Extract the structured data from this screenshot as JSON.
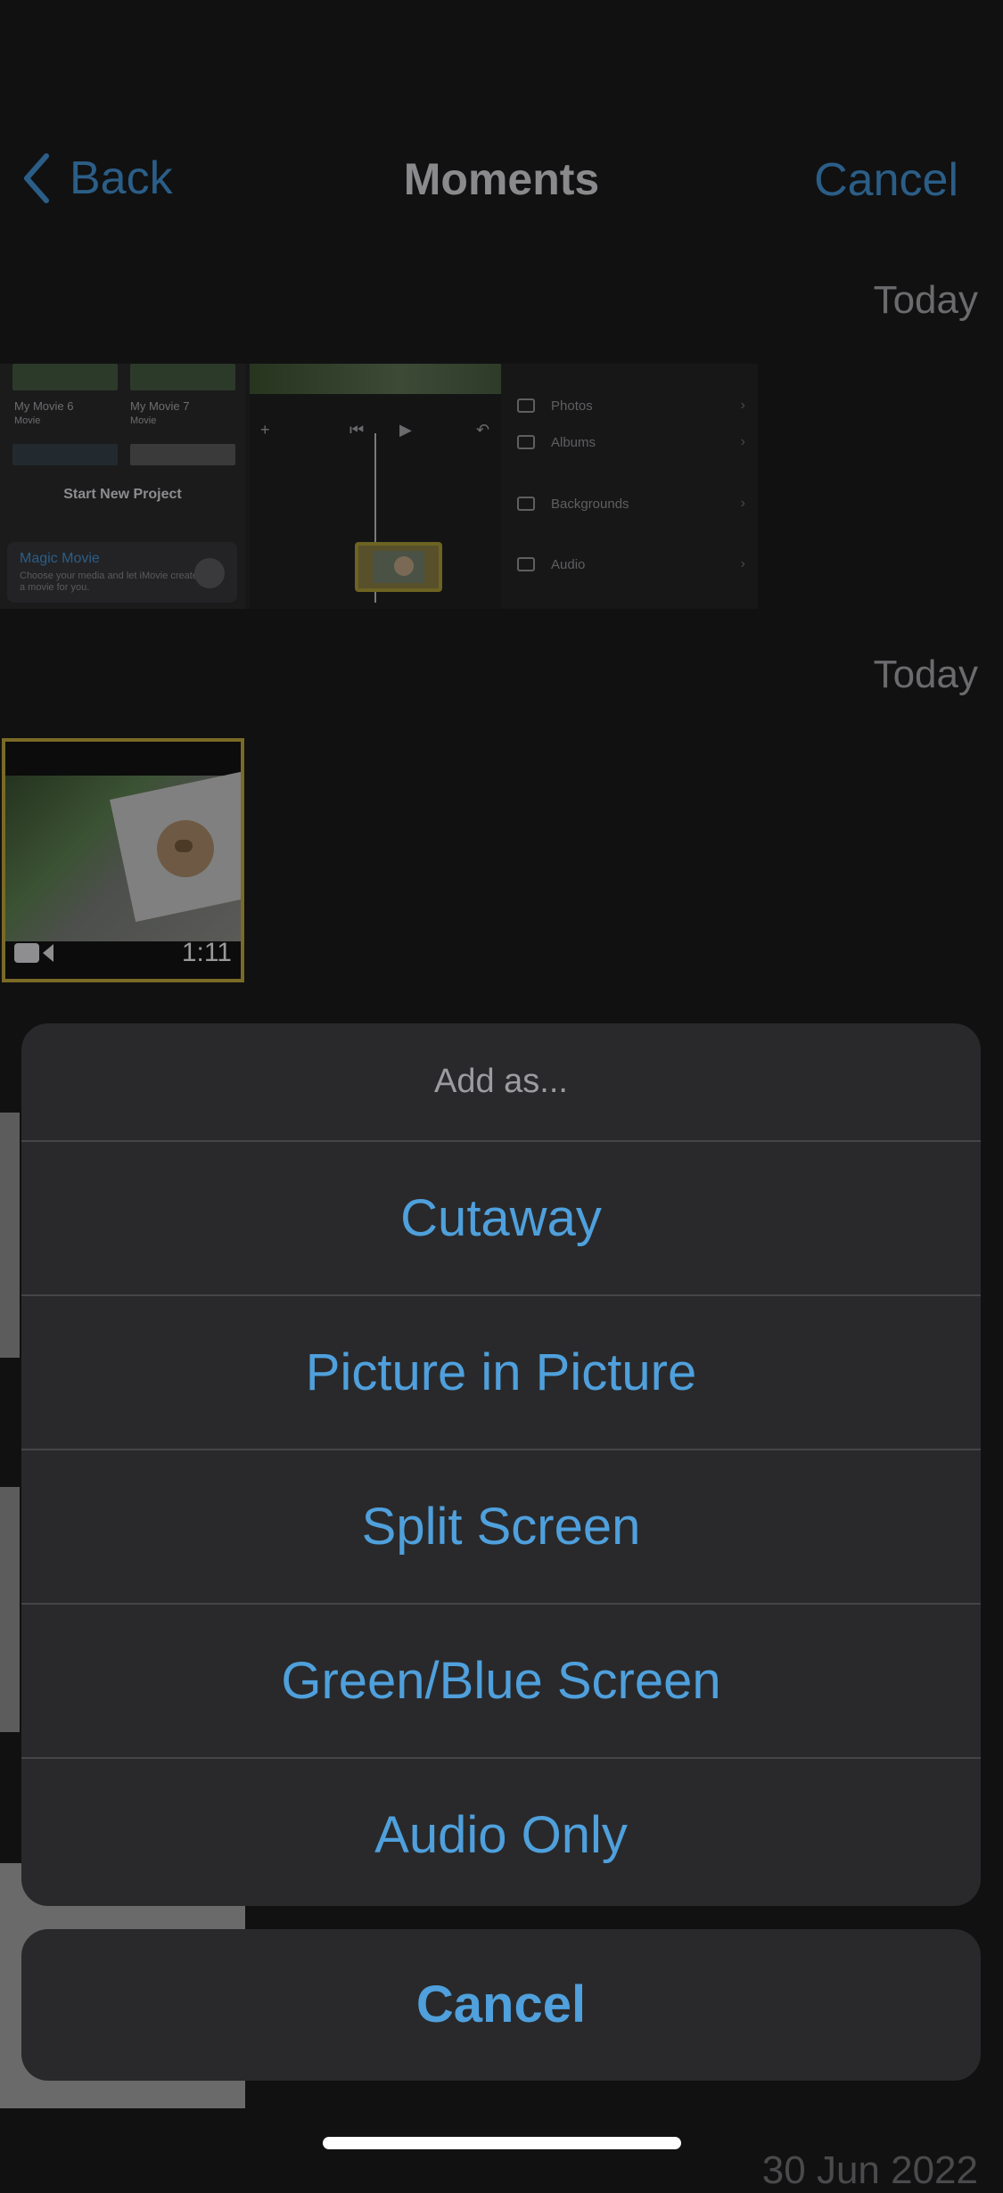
{
  "nav": {
    "back_label": "Back",
    "title": "Moments",
    "cancel_label": "Cancel"
  },
  "sections": [
    {
      "date": "Today"
    },
    {
      "date": "Today"
    }
  ],
  "strip": {
    "projects": [
      {
        "name": "My Movie 6",
        "type": "Movie"
      },
      {
        "name": "My Movie 7",
        "type": "Movie"
      }
    ],
    "start_new_project": "Start New Project",
    "magic_movie_title": "Magic Movie",
    "magic_movie_subtitle": "Choose your media and let iMovie create a movie for you.",
    "menu_items": [
      "Photos",
      "Albums",
      "Backgrounds",
      "Audio"
    ]
  },
  "video": {
    "duration": "1:11",
    "icon": "video-camera-icon"
  },
  "bottom_date": "30 Jun 2022",
  "sheet": {
    "title": "Add as...",
    "options": [
      "Cutaway",
      "Picture in Picture",
      "Split Screen",
      "Green/Blue Screen",
      "Audio Only"
    ],
    "cancel_label": "Cancel"
  },
  "colors": {
    "accent": "#4fa0dc",
    "sheet_bg": "#29292b",
    "selection_border": "#7a6a26"
  }
}
